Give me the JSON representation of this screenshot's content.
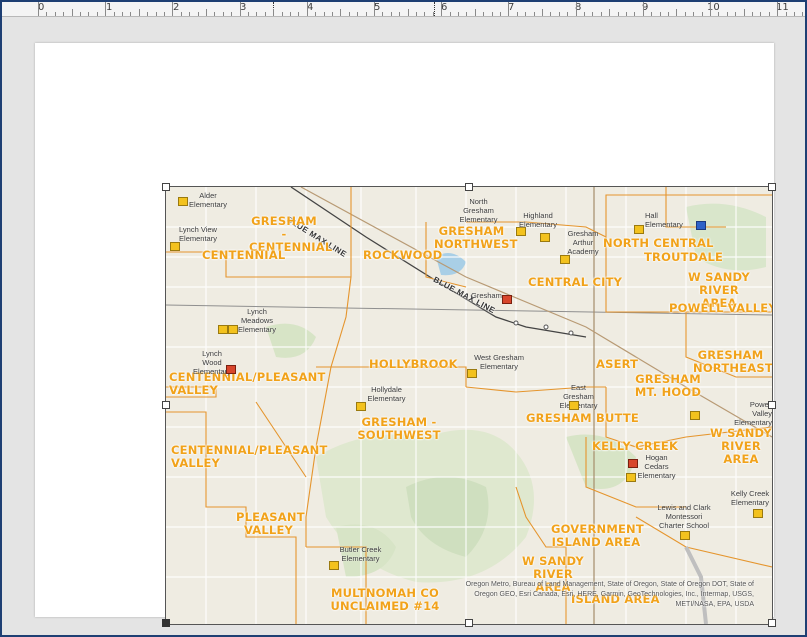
{
  "ruler": {
    "labels": [
      "0",
      "1",
      "2",
      "3",
      "4",
      "5",
      "6",
      "7",
      "8",
      "9",
      "10",
      "11"
    ]
  },
  "map": {
    "bluemax": [
      "BLUE MAX LINE",
      "BLUE MAX LINE"
    ],
    "areas": [
      {
        "id": "gresham-centennial",
        "text": "GRESHAM - CENTENNIAL"
      },
      {
        "id": "centennial",
        "text": "CENTENNIAL"
      },
      {
        "id": "rockwood",
        "text": "ROCKWOOD"
      },
      {
        "id": "gresham-northwest",
        "text": "GRESHAM NORTHWEST"
      },
      {
        "id": "north-central",
        "text": "NORTH CENTRAL"
      },
      {
        "id": "troutdale",
        "text": "TROUTDALE"
      },
      {
        "id": "central-city",
        "text": "CENTRAL CITY"
      },
      {
        "id": "w-sandy-river-area-1",
        "text": "W SANDY RIVER AREA"
      },
      {
        "id": "powell-valley",
        "text": "POWELL VALLEY"
      },
      {
        "id": "gresham-northeast",
        "text": "GRESHAM NORTHEAST"
      },
      {
        "id": "hollybrook",
        "text": "HOLLYBROOK"
      },
      {
        "id": "centennial-pleasant-valley-1",
        "text": "CENTENNIAL/PLEASANT VALLEY"
      },
      {
        "id": "asert",
        "text": "ASERT"
      },
      {
        "id": "gresham-mt-hood",
        "text": "GRESHAM MT. HOOD"
      },
      {
        "id": "gresham-butte",
        "text": "GRESHAM BUTTE"
      },
      {
        "id": "gresham-southwest",
        "text": "GRESHAM - SOUTHWEST"
      },
      {
        "id": "w-sandy-river-area-2",
        "text": "W SANDY RIVER AREA"
      },
      {
        "id": "kelly-creek",
        "text": "KELLY CREEK"
      },
      {
        "id": "centennial-pleasant-valley-2",
        "text": "CENTENNIAL/PLEASANT VALLEY"
      },
      {
        "id": "pleasant-valley",
        "text": "PLEASANT VALLEY"
      },
      {
        "id": "government-island-area",
        "text": "GOVERNMENT ISLAND AREA"
      },
      {
        "id": "w-sandy-river-area-3",
        "text": "W SANDY RIVER AREA"
      },
      {
        "id": "island-area",
        "text": "ISLAND AREA"
      },
      {
        "id": "multnomah-co-unclaimed",
        "text": "MULTNOMAH CO UNCLAIMED #14"
      }
    ],
    "schools": [
      {
        "id": "alder",
        "text": "Alder Elementary"
      },
      {
        "id": "lynch-view",
        "text": "Lynch View Elementary"
      },
      {
        "id": "north-gresham",
        "text": "North Gresham Elementary"
      },
      {
        "id": "highland",
        "text": "Highland Elementary"
      },
      {
        "id": "gresham-arthur",
        "text": "Gresham Arthur Academy"
      },
      {
        "id": "hall",
        "text": "Hall Elementary"
      },
      {
        "id": "lynch-meadows",
        "text": "Lynch Meadows Elementary"
      },
      {
        "id": "gresham",
        "text": "Gresham"
      },
      {
        "id": "lynch-wood",
        "text": "Lynch Wood Elementary"
      },
      {
        "id": "west-gresham",
        "text": "West Gresham Elementary"
      },
      {
        "id": "hollydale",
        "text": "Hollydale Elementary"
      },
      {
        "id": "east-gresham",
        "text": "East Gresham Elementary"
      },
      {
        "id": "powell-valley",
        "text": "Powell Valley Elementary"
      },
      {
        "id": "hogan-cedars",
        "text": "Hogan Cedars Elementary"
      },
      {
        "id": "kelly-creek",
        "text": "Kelly Creek Elementary"
      },
      {
        "id": "lewis-clark",
        "text": "Lewis and Clark Montessori Charter School"
      },
      {
        "id": "butler-creek",
        "text": "Butler Creek Elementary"
      }
    ],
    "attribution": "Oregon Metro, Bureau of Land Management, State of Oregon, State of Oregon DOT, State of Oregon GEO, Esri Canada, Esri, HERE, Garmin, GeoTechnologies, Inc., Intermap, USGS, METI/NASA, EPA, USDA"
  }
}
